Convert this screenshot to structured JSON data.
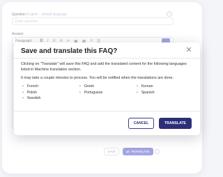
{
  "background_editor": {
    "question_label": "Question",
    "question_label_hint": "English - default language",
    "question_placeholder": "Enter question",
    "answer_label": "Answer",
    "toolbar_paragraph": "Paragraph",
    "answer_text": "",
    "save_label": "SAVE",
    "translate_label": "TRANSLATE"
  },
  "modal": {
    "title": "Save and translate this FAQ?",
    "close_glyph": "✕",
    "paragraph_1": "Clicking on \"Translate\" will save this FAQ and add the translated content for the following languages listed in Machine translation section.",
    "paragraph_2": "It may take a couple minutes to process. You will be notified when the translations are done.",
    "languages": [
      "French",
      "Greek",
      "Korean",
      "Polish",
      "Portuguese",
      "Spanish",
      "Swedish"
    ],
    "cancel_label": "CANCEL",
    "translate_label": "TRANSLATE"
  },
  "colors": {
    "primary": "#2c2f78",
    "accent": "#5b5fc7",
    "page_bg": "#f4f5f9"
  }
}
